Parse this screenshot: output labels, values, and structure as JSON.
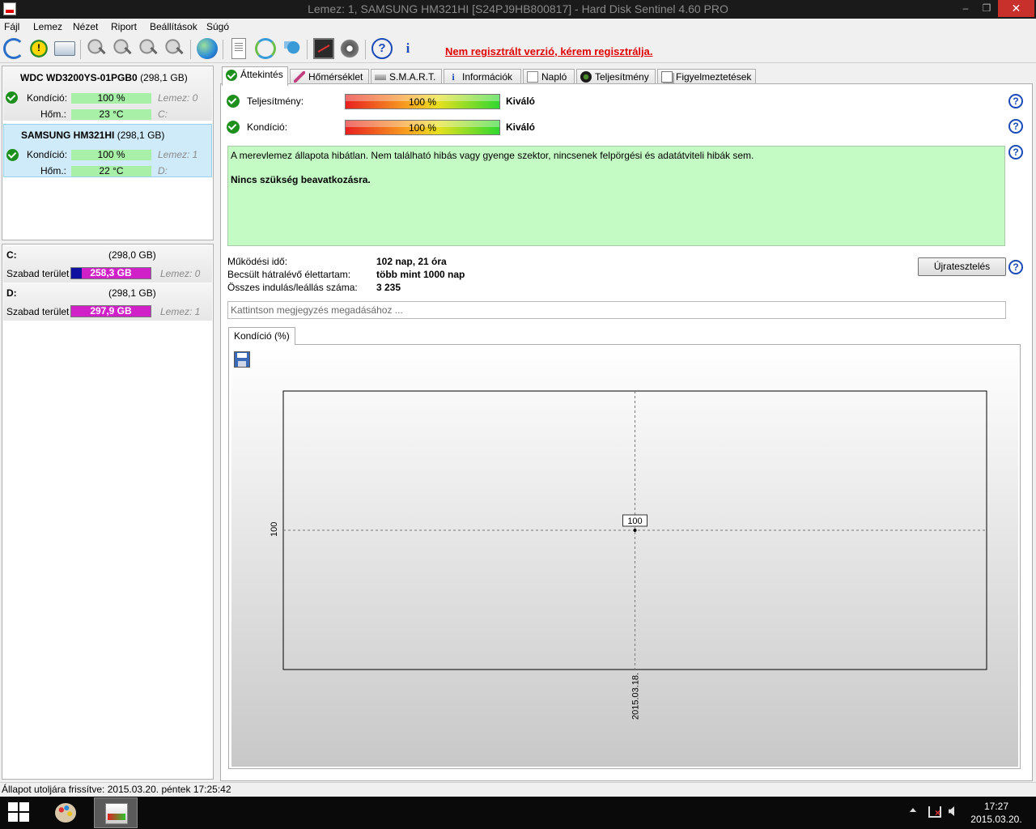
{
  "window": {
    "title": "Lemez: 1, SAMSUNG HM321HI [S24PJ9HB800817]  -  Hard Disk Sentinel 4.60 PRO",
    "minimize": "‒",
    "maximize": "❐",
    "close": "✕"
  },
  "menu": {
    "items": [
      "Fájl",
      "Lemez",
      "Nézet",
      "Riport",
      "Beállítások",
      "Súgó"
    ]
  },
  "toolbar": {
    "register_text": "Nem regisztrált verzió, kérem regisztrálja.",
    "help_glyph": "?",
    "info_glyph": "i",
    "icons": [
      "refresh-icon",
      "warning-icon",
      "disk-icon",
      "probe-icon",
      "probe-icon",
      "probe-check-icon",
      "probe-search-icon",
      "globe-icon",
      "report-icon",
      "sync-icon",
      "network-icon",
      "performance-icon",
      "speaker-icon",
      "help-icon",
      "info-icon"
    ]
  },
  "disks": [
    {
      "name": "WDC WD3200YS-01PGB0",
      "size": "(298,1 GB)",
      "condition_label": "Kondíció:",
      "condition_value": "100 %",
      "temp_label": "Hőm.:",
      "temp_value": "23 °C",
      "disk_hint": "Lemez: 0",
      "drive_hint": "C:",
      "selected": false
    },
    {
      "name": "SAMSUNG HM321HI",
      "size": "(298,1 GB)",
      "condition_label": "Kondíció:",
      "condition_value": "100 %",
      "temp_label": "Hőm.:",
      "temp_value": "22 °C",
      "disk_hint": "Lemez: 1",
      "drive_hint": "D:",
      "selected": true
    }
  ],
  "volumes": [
    {
      "letter": "C:",
      "size": "(298,0 GB)",
      "free_label": "Szabad terület",
      "free_value": "258,3 GB",
      "used_fraction": 0.13,
      "disk_hint": "Lemez: 0"
    },
    {
      "letter": "D:",
      "size": "(298,1 GB)",
      "free_label": "Szabad terület",
      "free_value": "297,9 GB",
      "used_fraction": 0.0,
      "disk_hint": "Lemez: 1"
    }
  ],
  "tabs": [
    {
      "label": "Áttekintés",
      "icon": "check-icon",
      "active": true
    },
    {
      "label": "Hőmérséklet",
      "icon": "thermometer-icon",
      "active": false
    },
    {
      "label": "S.M.A.R.T.",
      "icon": "smart-icon",
      "active": false
    },
    {
      "label": "Információk",
      "icon": "info-icon",
      "active": false
    },
    {
      "label": "Napló",
      "icon": "log-icon",
      "active": false
    },
    {
      "label": "Teljesítmény",
      "icon": "gauge-icon",
      "active": false
    },
    {
      "label": "Figyelmeztetések",
      "icon": "alerts-icon",
      "active": false
    }
  ],
  "overview": {
    "performance_label": "Teljesítmény:",
    "performance_value": "100 %",
    "performance_rating": "Kiváló",
    "condition_label": "Kondíció:",
    "condition_value": "100 %",
    "condition_rating": "Kiváló",
    "help_glyph": "?",
    "status_line1": "A merevlemez állapota hibátlan. Nem található hibás vagy gyenge szektor, nincsenek felpörgési és adatátviteli hibák sem.",
    "status_line2": "Nincs szükség beavatkozásra.",
    "uptime_label": "Működési idő:",
    "uptime_value": "102 nap, 21 óra",
    "lifetime_label": "Becsült hátralévő élettartam:",
    "lifetime_value": "több mint 1000 nap",
    "startstop_label": "Összes indulás/leállás száma:",
    "startstop_value": "3 235",
    "retest_button": "Újratesztelés",
    "note_placeholder": "Kattintson megjegyzés megadásához ..."
  },
  "chart_tab_label": "Kondíció  (%)",
  "chart_data": {
    "type": "line",
    "title": "Kondíció  (%)",
    "x": [
      "2015.03.18."
    ],
    "series": [
      {
        "values": [
          100
        ]
      }
    ],
    "xlabel": "",
    "ylabel": "",
    "ytick": "100",
    "point_label": "100",
    "grid": true
  },
  "statusbar": {
    "text": "Állapot utoljára frissítve: 2015.03.20. péntek 17:25:42"
  },
  "taskbar": {
    "time": "17:27",
    "date": "2015.03.20."
  }
}
